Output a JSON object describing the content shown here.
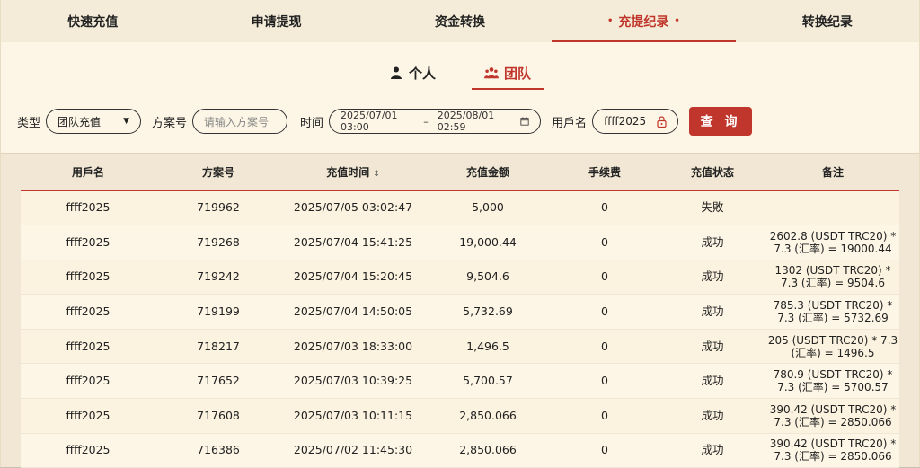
{
  "top_tabs": [
    {
      "label": "快速充值",
      "active": false
    },
    {
      "label": "申请提现",
      "active": false
    },
    {
      "label": "资金转换",
      "active": false
    },
    {
      "label": "充提纪录",
      "active": true
    },
    {
      "label": "转换纪录",
      "active": false
    }
  ],
  "sub_tabs": {
    "personal": "个人",
    "team": "团队",
    "active": "team"
  },
  "filters": {
    "type_label": "类型",
    "type_value": "团队充值",
    "order_label": "方案号",
    "order_placeholder": "请输入方案号",
    "time_label": "时间",
    "date_start": "2025/07/01 03:00",
    "date_sep": "–",
    "date_end": "2025/08/01 02:59",
    "user_label": "用戶名",
    "user_value": "ffff2025",
    "query_label": "查 询"
  },
  "table": {
    "headers": [
      "用戶名",
      "方案号",
      "充值时间",
      "充值金额",
      "手续费",
      "充值状态",
      "备注"
    ],
    "rows": [
      {
        "user": "ffff2025",
        "order": "719962",
        "time": "2025/07/05 03:02:47",
        "amount": "5,000",
        "fee": "0",
        "status": "失敗",
        "note1": "–",
        "note2": ""
      },
      {
        "user": "ffff2025",
        "order": "719268",
        "time": "2025/07/04 15:41:25",
        "amount": "19,000.44",
        "fee": "0",
        "status": "成功",
        "note1": "2602.8 (USDT TRC20) *",
        "note2": "7.3 (汇率) = 19000.44"
      },
      {
        "user": "ffff2025",
        "order": "719242",
        "time": "2025/07/04 15:20:45",
        "amount": "9,504.6",
        "fee": "0",
        "status": "成功",
        "note1": "1302 (USDT TRC20) *",
        "note2": "7.3 (汇率) = 9504.6"
      },
      {
        "user": "ffff2025",
        "order": "719199",
        "time": "2025/07/04 14:50:05",
        "amount": "5,732.69",
        "fee": "0",
        "status": "成功",
        "note1": "785.3 (USDT TRC20) *",
        "note2": "7.3 (汇率) = 5732.69"
      },
      {
        "user": "ffff2025",
        "order": "718217",
        "time": "2025/07/03 18:33:00",
        "amount": "1,496.5",
        "fee": "0",
        "status": "成功",
        "note1": "205 (USDT TRC20) * 7.3",
        "note2": "(汇率) = 1496.5"
      },
      {
        "user": "ffff2025",
        "order": "717652",
        "time": "2025/07/03 10:39:25",
        "amount": "5,700.57",
        "fee": "0",
        "status": "成功",
        "note1": "780.9 (USDT TRC20) *",
        "note2": "7.3 (汇率) = 5700.57"
      },
      {
        "user": "ffff2025",
        "order": "717608",
        "time": "2025/07/03 10:11:15",
        "amount": "2,850.066",
        "fee": "0",
        "status": "成功",
        "note1": "390.42 (USDT TRC20) *",
        "note2": "7.3 (汇率) = 2850.066"
      },
      {
        "user": "ffff2025",
        "order": "716386",
        "time": "2025/07/02 11:45:30",
        "amount": "2,850.066",
        "fee": "0",
        "status": "成功",
        "note1": "390.42 (USDT TRC20) *",
        "note2": "7.3 (汇率) = 2850.066"
      }
    ]
  },
  "colors": {
    "accent": "#c0362c",
    "background": "#fdf6e6",
    "header_band": "#f4ecd8"
  }
}
